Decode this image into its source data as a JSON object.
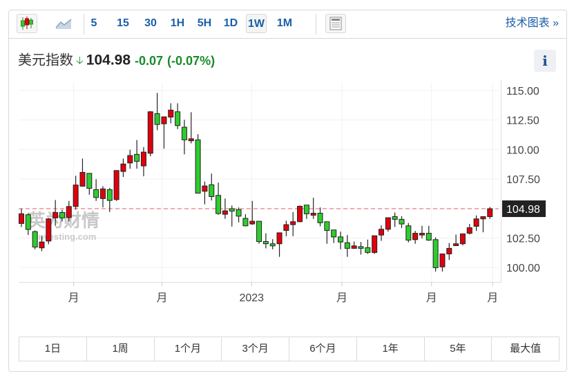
{
  "toolbar": {
    "chart_types": [
      {
        "icon": "candlestick-icon",
        "selected": true
      },
      {
        "icon": "area-chart-icon",
        "selected": false
      }
    ],
    "intervals": [
      {
        "label": "5",
        "selected": false
      },
      {
        "label": "15",
        "selected": false
      },
      {
        "label": "30",
        "selected": false
      },
      {
        "label": "1H",
        "selected": false
      },
      {
        "label": "5H",
        "selected": false
      },
      {
        "label": "1D",
        "selected": false
      },
      {
        "label": "1W",
        "selected": true
      },
      {
        "label": "1M",
        "selected": false
      }
    ],
    "layout_icon": "news-layout-icon",
    "tech_chart_label": "技术图表 »"
  },
  "header": {
    "name": "美元指数",
    "direction_icon": "down-arrow-icon",
    "price": "104.98",
    "change": "-0.07",
    "change_pct": "(-0.07%)",
    "info_label": "i"
  },
  "colors": {
    "up": "#e0000c",
    "down": "#2ecc2e",
    "last_line": "#e4606c",
    "text_down": "#1a8a2a",
    "accent": "#1a5fa8"
  },
  "chart_data": {
    "type": "candlestick",
    "ylim": [
      99,
      116
    ],
    "y_ticks": [
      "115.00",
      "112.50",
      "110.00",
      "107.50",
      "102.50",
      "100.00"
    ],
    "y_tick_values": [
      115,
      112.5,
      110,
      107.5,
      102.5,
      100
    ],
    "last_price": 104.98,
    "last_price_label": "104.98",
    "x_ticks": [
      {
        "label": "月",
        "index": 7.7
      },
      {
        "label": "月",
        "index": 20.7
      },
      {
        "label": "2023",
        "index": 33.9
      },
      {
        "label": "月",
        "index": 47.2
      },
      {
        "label": "月",
        "index": 60.4
      },
      {
        "label": "月",
        "index": 69.4
      }
    ],
    "watermark": "英为财情 Investing.com",
    "ohlc": [
      [
        103.73,
        105.0,
        103.43,
        104.55
      ],
      [
        104.47,
        104.6,
        102.75,
        103.22
      ],
      [
        103.04,
        103.14,
        101.54,
        101.73
      ],
      [
        101.66,
        102.65,
        101.38,
        102.16
      ],
      [
        102.24,
        104.2,
        101.97,
        104.12
      ],
      [
        104.2,
        105.72,
        103.53,
        104.66
      ],
      [
        104.66,
        104.9,
        103.9,
        104.2
      ],
      [
        104.23,
        105.64,
        103.9,
        105.17
      ],
      [
        105.17,
        107.77,
        104.9,
        106.99
      ],
      [
        106.89,
        109.23,
        106.85,
        108.06
      ],
      [
        107.98,
        107.98,
        106.17,
        106.71
      ],
      [
        106.6,
        107.48,
        105.64,
        105.93
      ],
      [
        105.84,
        106.89,
        105.09,
        106.66
      ],
      [
        106.6,
        106.75,
        104.7,
        105.68
      ],
      [
        105.76,
        108.22,
        105.64,
        108.22
      ],
      [
        108.14,
        109.23,
        107.67,
        108.77
      ],
      [
        108.86,
        109.98,
        108.37,
        109.49
      ],
      [
        109.59,
        110.8,
        108.37,
        109.0
      ],
      [
        108.61,
        110.21,
        107.73,
        109.78
      ],
      [
        109.68,
        113.26,
        109.43,
        113.2
      ],
      [
        113.04,
        114.8,
        111.64,
        112.12
      ],
      [
        112.18,
        112.77,
        110.07,
        112.77
      ],
      [
        112.75,
        113.92,
        112.22,
        113.34
      ],
      [
        113.2,
        113.92,
        111.73,
        112.03
      ],
      [
        111.89,
        112.52,
        109.59,
        110.82
      ],
      [
        110.74,
        113.16,
        110.52,
        110.91
      ],
      [
        110.82,
        111.3,
        106.3,
        106.3
      ],
      [
        106.46,
        107.28,
        105.35,
        106.91
      ],
      [
        107.01,
        107.96,
        105.68,
        106.01
      ],
      [
        106.11,
        107.2,
        104.47,
        104.57
      ],
      [
        104.51,
        105.84,
        104.12,
        104.8
      ],
      [
        104.98,
        105.25,
        103.47,
        104.78
      ],
      [
        104.9,
        105.09,
        103.82,
        104.35
      ],
      [
        104.16,
        104.51,
        103.49,
        103.53
      ],
      [
        103.69,
        105.64,
        103.61,
        103.92
      ],
      [
        103.92,
        103.92,
        102.01,
        102.2
      ],
      [
        102.2,
        102.9,
        101.62,
        102.01
      ],
      [
        102.01,
        102.4,
        101.54,
        101.83
      ],
      [
        102.01,
        102.94,
        100.9,
        102.94
      ],
      [
        103.14,
        103.96,
        102.65,
        103.63
      ],
      [
        103.63,
        104.7,
        102.65,
        103.88
      ],
      [
        103.88,
        105.25,
        103.84,
        105.19
      ],
      [
        105.29,
        105.29,
        104.12,
        104.55
      ],
      [
        104.43,
        105.91,
        104.12,
        104.6
      ],
      [
        104.6,
        105.09,
        103.49,
        103.79
      ],
      [
        103.88,
        103.88,
        102.01,
        103.14
      ],
      [
        103.18,
        103.18,
        102.07,
        102.59
      ],
      [
        102.59,
        103.04,
        101.54,
        102.16
      ],
      [
        102.1,
        102.75,
        100.9,
        101.62
      ],
      [
        101.62,
        102.2,
        101.58,
        101.83
      ],
      [
        101.77,
        102.16,
        101.09,
        101.62
      ],
      [
        101.68,
        102.36,
        101.15,
        101.27
      ],
      [
        101.27,
        102.69,
        101.15,
        102.69
      ],
      [
        102.75,
        103.57,
        102.26,
        103.24
      ],
      [
        103.24,
        104.22,
        103.04,
        104.22
      ],
      [
        104.31,
        104.66,
        103.43,
        104.08
      ],
      [
        104.08,
        104.35,
        103.34,
        103.69
      ],
      [
        103.53,
        103.77,
        102.13,
        102.32
      ],
      [
        102.36,
        103.1,
        102.01,
        102.9
      ],
      [
        102.75,
        103.53,
        102.46,
        102.9
      ],
      [
        102.9,
        103.53,
        102.26,
        102.32
      ],
      [
        102.36,
        102.55,
        99.66,
        99.98
      ],
      [
        100.05,
        101.15,
        99.66,
        101.15
      ],
      [
        101.15,
        102.07,
        100.64,
        101.62
      ],
      [
        101.85,
        102.79,
        101.81,
        102.01
      ],
      [
        102.01,
        102.85,
        101.87,
        102.85
      ],
      [
        102.9,
        103.69,
        102.79,
        103.37
      ],
      [
        103.49,
        104.41,
        103.1,
        104.12
      ],
      [
        104.12,
        104.35,
        102.98,
        104.31
      ],
      [
        104.31,
        105.13,
        104.12,
        104.98
      ]
    ]
  },
  "ranges": [
    "1日",
    "1周",
    "1个月",
    "3个月",
    "6个月",
    "1年",
    "5年",
    "最大值"
  ]
}
